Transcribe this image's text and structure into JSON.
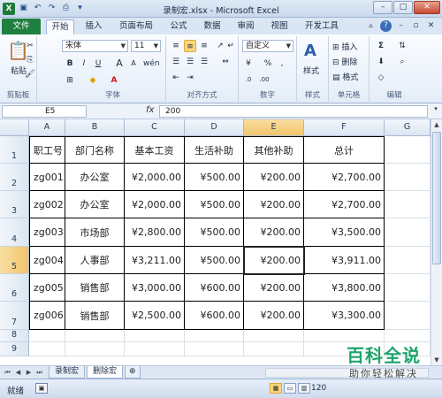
{
  "window": {
    "title": "录制宏.xlsx - Microsoft Excel",
    "app_icon": "excel-icon",
    "controls": [
      "–",
      "□",
      "✕"
    ]
  },
  "ribbon_tabs": [
    "文件",
    "开始",
    "插入",
    "页面布局",
    "公式",
    "数据",
    "审阅",
    "视图",
    "开发工具"
  ],
  "ribbon": {
    "clipboard": {
      "label": "剪贴板",
      "paste": "粘贴"
    },
    "font": {
      "label": "字体",
      "name": "宋体",
      "size": "11",
      "bold": "B",
      "italic": "I",
      "underline": "U",
      "grow": "A",
      "shrink": "A",
      "phonetic": "wén"
    },
    "alignment": {
      "label": "对齐方式"
    },
    "number": {
      "label": "数字",
      "format": "自定义",
      "currency": "¥",
      "percent": "%",
      "comma": ","
    },
    "styles": {
      "label": "样式",
      "button": "样式"
    },
    "cells": {
      "label": "单元格",
      "insert": "插入",
      "delete": "删除",
      "format": "格式"
    },
    "editing": {
      "label": "编辑"
    }
  },
  "formula_bar": {
    "name_box": "E5",
    "fx": "fx",
    "value": "200"
  },
  "columns": [
    "A",
    "B",
    "C",
    "D",
    "E",
    "F",
    "G"
  ],
  "rows": [
    "1",
    "2",
    "3",
    "4",
    "5",
    "6",
    "7",
    "8",
    "9"
  ],
  "table": {
    "headers": [
      "职工号",
      "部门名称",
      "基本工资",
      "生活补助",
      "其他补助",
      "总计"
    ],
    "rows": [
      [
        "zg001",
        "办公室",
        "¥2,000.00",
        "¥500.00",
        "¥200.00",
        "¥2,700.00"
      ],
      [
        "zg002",
        "办公室",
        "¥2,000.00",
        "¥500.00",
        "¥200.00",
        "¥2,700.00"
      ],
      [
        "zg003",
        "市场部",
        "¥2,800.00",
        "¥500.00",
        "¥200.00",
        "¥3,500.00"
      ],
      [
        "zg004",
        "人事部",
        "¥3,211.00",
        "¥500.00",
        "¥200.00",
        "¥3,911.00"
      ],
      [
        "zg005",
        "销售部",
        "¥3,000.00",
        "¥600.00",
        "¥200.00",
        "¥3,800.00"
      ],
      [
        "zg006",
        "销售部",
        "¥2,500.00",
        "¥600.00",
        "¥200.00",
        "¥3,300.00"
      ]
    ]
  },
  "sheet_tabs": [
    "录制宏",
    "删除宏"
  ],
  "status": {
    "ready": "就绪",
    "zoom": "120"
  },
  "watermark": {
    "title": "百科全说",
    "subtitle": "助你轻松解决"
  }
}
